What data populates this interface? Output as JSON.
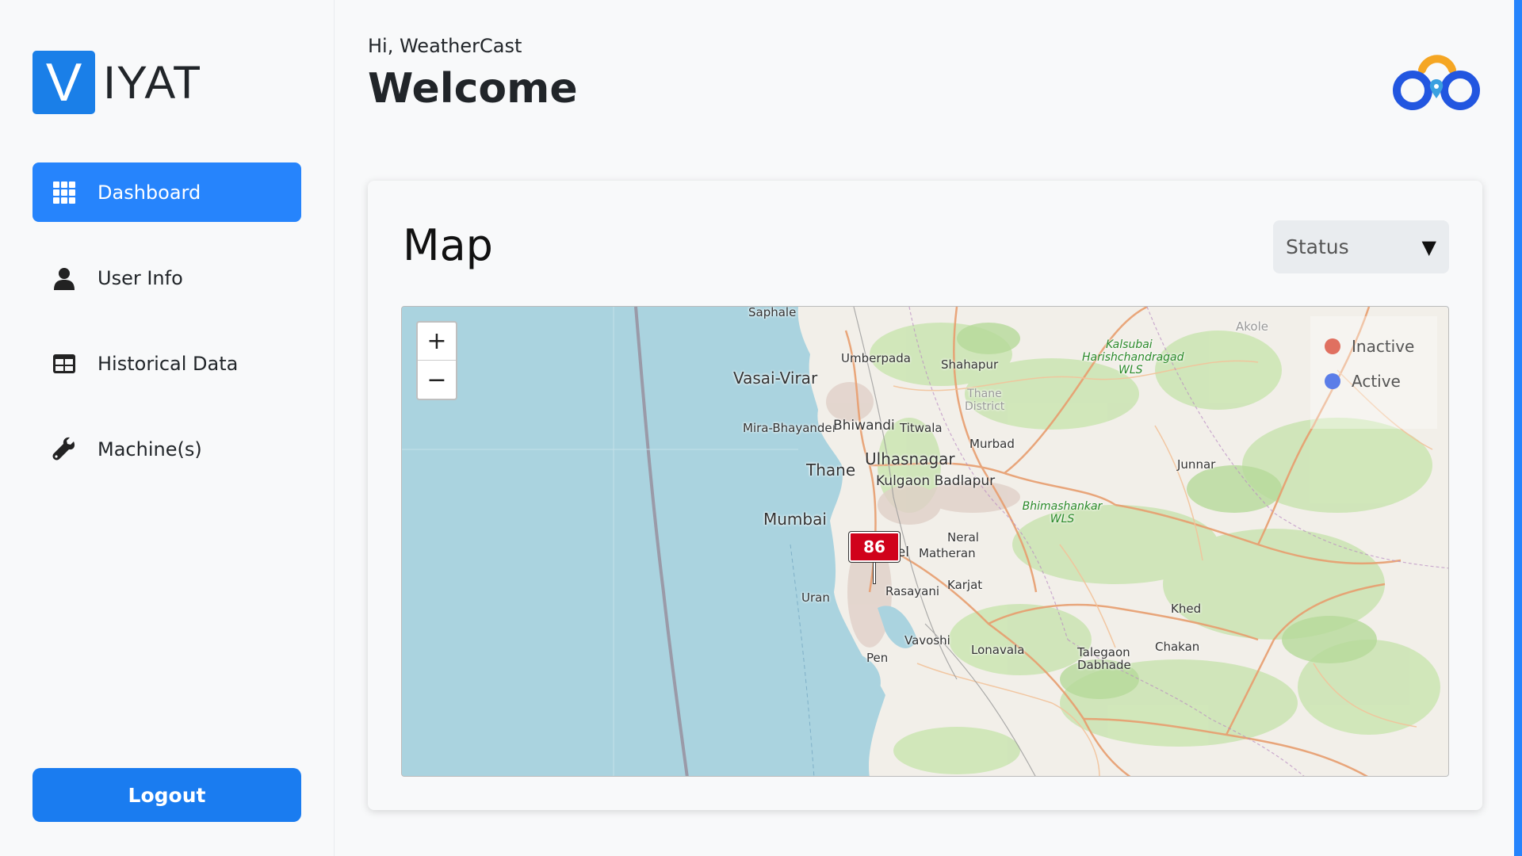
{
  "sidebar": {
    "logo_letter": "V",
    "logo_text": "IYAT",
    "items": [
      {
        "label": "Dashboard",
        "icon": "grid-icon",
        "active": true
      },
      {
        "label": "User Info",
        "icon": "user-icon",
        "active": false
      },
      {
        "label": "Historical Data",
        "icon": "table-icon",
        "active": false
      },
      {
        "label": "Machine(s)",
        "icon": "wrench-icon",
        "active": false
      }
    ],
    "logout_label": "Logout"
  },
  "header": {
    "greeting": "Hi, WeatherCast",
    "title": "Welcome"
  },
  "card": {
    "title": "Map",
    "status_select": {
      "value": "Status",
      "arrow": "▼"
    }
  },
  "map": {
    "zoom_in": "+",
    "zoom_out": "−",
    "legend": [
      {
        "label": "Inactive",
        "color": "#e07060"
      },
      {
        "label": "Active",
        "color": "#5b7de8"
      }
    ],
    "marker_value": "86",
    "marker_color": "#d0021b",
    "places": {
      "saphale": "Saphale",
      "umberpada": "Umberpada",
      "shahapur": "Shahapur",
      "vasai_virar": "Vasai-Virar",
      "kalsubai": "Kalsubai",
      "harishchandragad": "Harishchandragad",
      "wls": "WLS",
      "akole": "Akole",
      "thane_district": "Thane District",
      "mira_bhayander": "Mira-Bhayander",
      "bhiwandi": "Bhiwandi",
      "titwala": "Titwala",
      "murbad": "Murbad",
      "ulhasnagar": "Ulhasnagar",
      "thane": "Thane",
      "junnar": "Junnar",
      "kulgaon_badlapur": "Kulgaon Badlapur",
      "mumbai": "Mumbai",
      "bhimashankar": "Bhimashankar WLS",
      "neral": "Neral",
      "panvel": "Panvel",
      "matheran": "Matheran",
      "karjat": "Karjat",
      "rasayani": "Rasayani",
      "uran": "Uran",
      "khed": "Khed",
      "vavoshi": "Vavoshi",
      "lonavala": "Lonavala",
      "chakan": "Chakan",
      "talegaon_dabhade": "Talegaon Dabhade",
      "pen": "Pen"
    }
  },
  "colors": {
    "primary": "#2684fc",
    "sea": "#aad3df",
    "land": "#f2efe9"
  }
}
